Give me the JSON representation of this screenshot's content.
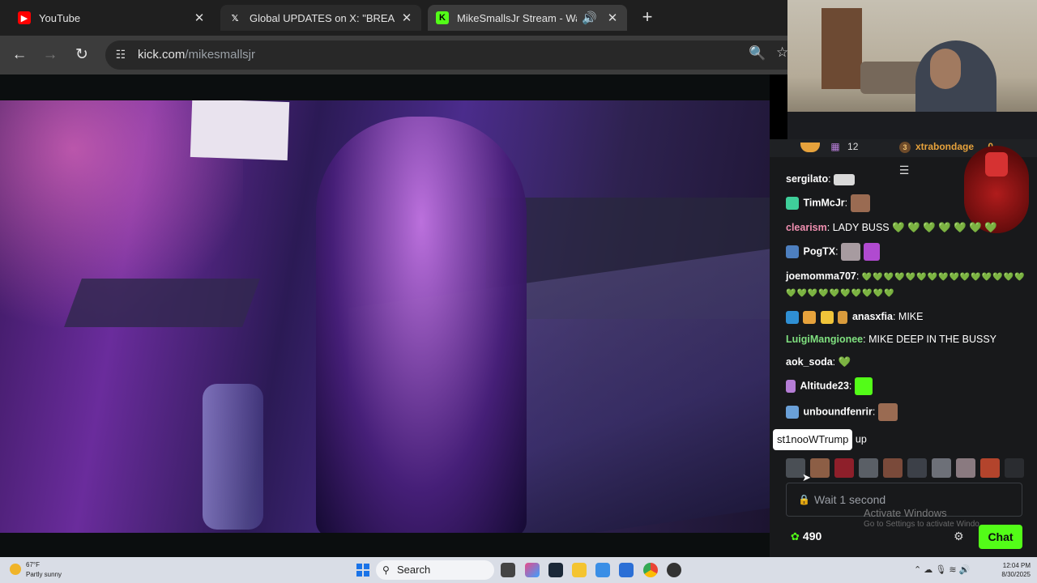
{
  "browser": {
    "tabs": [
      {
        "title": "YouTube",
        "icon": "youtube-icon"
      },
      {
        "title": "Global UPDATES on X: \"BREAKIN",
        "icon": "x-icon"
      },
      {
        "title": "MikeSmallsJr Stream - Watc",
        "icon": "kick-icon"
      }
    ],
    "url_host": "kick.com",
    "url_path": "/mikesmallsjr"
  },
  "pinned": {
    "sub_count": "12",
    "top_user": "xtrabondage",
    "top_badge": "3",
    "top_value": "0"
  },
  "chat": {
    "messages": [
      {
        "user": "sergilato",
        "sep": ":",
        "text": ""
      },
      {
        "user": "TimMcJr",
        "sep": ":",
        "text": ""
      },
      {
        "user": "clearism",
        "sep": ":",
        "text": " LADY BUSS",
        "hearts": "💚 💚 💚 💚 💚 💚 💚"
      },
      {
        "user": "PogTX",
        "sep": ":",
        "text": ""
      },
      {
        "user": "joemomma707",
        "sep": ":",
        "text": "",
        "hearts": "💚💚💚💚💚💚💚💚💚💚💚💚💚💚💚💚💚💚💚💚💚💚💚💚💚"
      },
      {
        "user": "anasxfia",
        "sep": ":",
        "text": " MIKE"
      },
      {
        "user": "LuigiMangionee",
        "sep": ":",
        "text": " MIKE DEEP IN THE BUSSY"
      },
      {
        "user": "aok_soda",
        "sep": ":",
        "text": "",
        "hearts": "💚"
      },
      {
        "user": "Altitude23",
        "sep": ":",
        "text": ""
      },
      {
        "user": "unboundfenrir",
        "sep": ":",
        "text": ""
      },
      {
        "user": "st1nooWTrump",
        "sep": "",
        "text": "up"
      }
    ],
    "input_placeholder": "Wait 1 second",
    "points": "490",
    "send_label": "Chat",
    "activate_title": "Activate Windows",
    "activate_sub": "Go to Settings to activate Windo"
  },
  "taskbar": {
    "temp": "67°F",
    "condition": "Partly sunny",
    "search_label": "Search",
    "time": "12:04 PM",
    "date": "8/30/2025"
  },
  "colors": {
    "kick_green": "#53fc18",
    "heart_green": "#3cc47c"
  }
}
